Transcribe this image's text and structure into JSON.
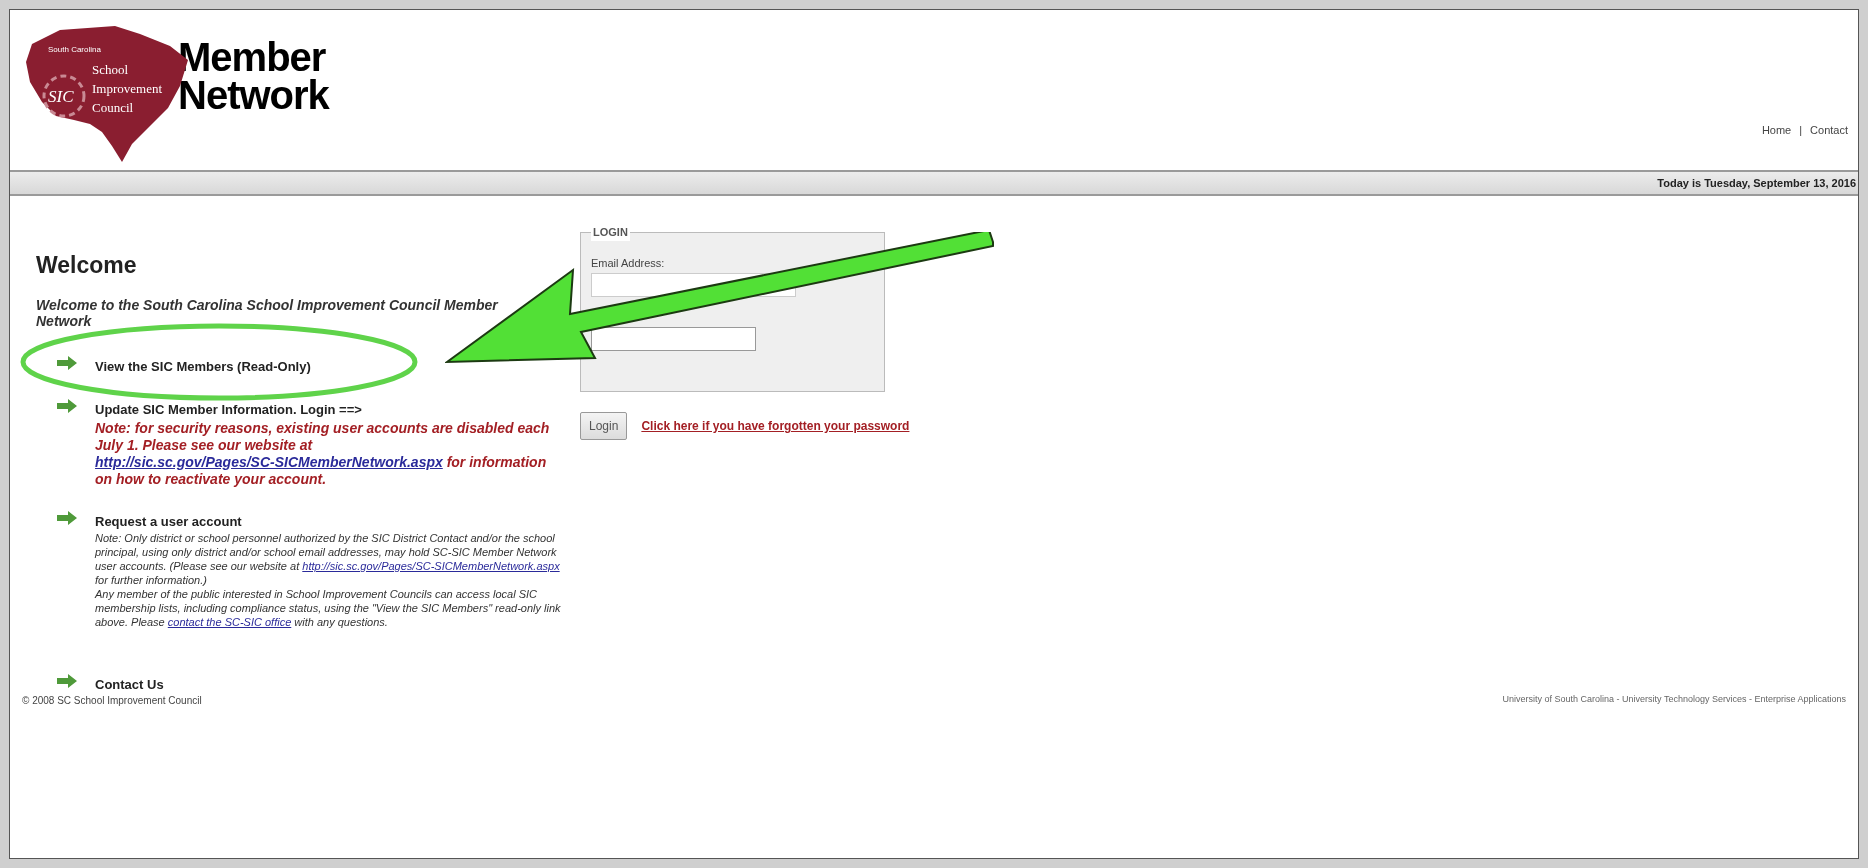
{
  "header": {
    "logo": {
      "small": "South Carolina",
      "emblem": "SIC",
      "lines": [
        "School",
        "Improvement",
        "Council"
      ]
    },
    "title_lines": [
      "Member",
      "Network"
    ],
    "nav": [
      {
        "label": "Home"
      },
      {
        "label": "Contact"
      }
    ],
    "nav_separator": "|"
  },
  "date_bar": {
    "text": "Today is Tuesday, September 13, 2016"
  },
  "welcome": {
    "heading": "Welcome",
    "intro": "Welcome to the South Carolina School Improvement Council Member Network"
  },
  "items": [
    {
      "kind": "link",
      "label": "View the SIC Members (Read-Only)"
    },
    {
      "kind": "login",
      "label": "Update SIC Member Information. Login ==>",
      "note": {
        "before": "Note: for security reasons, existing user accounts are disabled each July 1. Please see our website at",
        "link": "http://sic.sc.gov/Pages/SC-SICMemberNetwork.aspx",
        "after": "for information on how to reactivate your account."
      }
    },
    {
      "kind": "request",
      "label": "Request a user account",
      "note": {
        "before": "Note: Only district or school personnel authorized by the SIC District Contact and/or the school principal, using only district and/or school email addresses, may hold SC-SIC Member Network user accounts. (Please see our website at",
        "link": "http://sic.sc.gov/Pages/SC-SICMemberNetwork.aspx",
        "after": "for further information.)"
      },
      "note2": {
        "before": "Any member of the public interested in School Improvement Councils can access local SIC membership lists, including compliance status, using the \"View the SIC Members\" read-only link above. Please",
        "link": "contact the SC-SIC office",
        "after": "with any questions."
      }
    },
    {
      "kind": "link",
      "label": "Contact Us"
    }
  ],
  "login": {
    "legend": "LOGIN",
    "email_label": "Email Address:",
    "button": "Login",
    "forgot": "Click here if you have forgotten your password"
  },
  "footer": {
    "copyright": "© 2008 SC School Improvement Council",
    "credits": "University of South Carolina - University Technology Services - Enterprise Applications"
  }
}
